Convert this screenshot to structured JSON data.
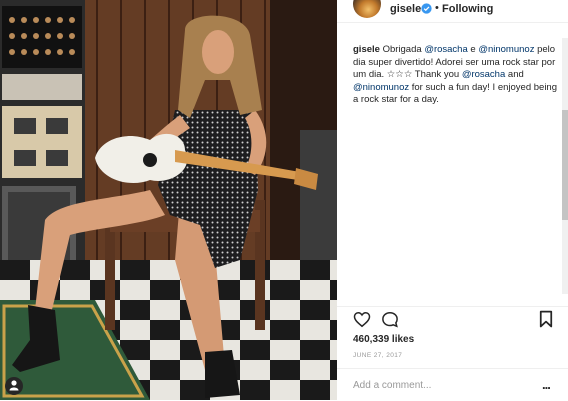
{
  "post": {
    "username": "gisele",
    "follow_separator": "•",
    "follow_status": "Following",
    "caption_user": "gisele",
    "caption_parts": {
      "p1": " Obrigada ",
      "m1": "@rosacha",
      "p2": " e ",
      "m2": "@ninomunoz",
      "p3": " pelo dia super divertido! Adorei ser uma rock star por um dia. ☆☆☆ Thank you ",
      "m3": "@rosacha",
      "p4": " and ",
      "m4": "@ninomunoz",
      "p5": " for such a fun day! I enjoyed being a rock star for a day."
    },
    "likes": "460,339 likes",
    "date": "JUNE 27, 2017",
    "comment_placeholder": "Add a comment...",
    "more_label": "..."
  },
  "icons": {
    "verified": "verified-badge-icon",
    "like": "heart-icon",
    "comment": "comment-bubble-icon",
    "save": "bookmark-icon",
    "tag": "user-tag-icon"
  },
  "colors": {
    "verified": "#3897f0",
    "text": "#262626",
    "mention": "#003569",
    "muted": "#999999"
  }
}
